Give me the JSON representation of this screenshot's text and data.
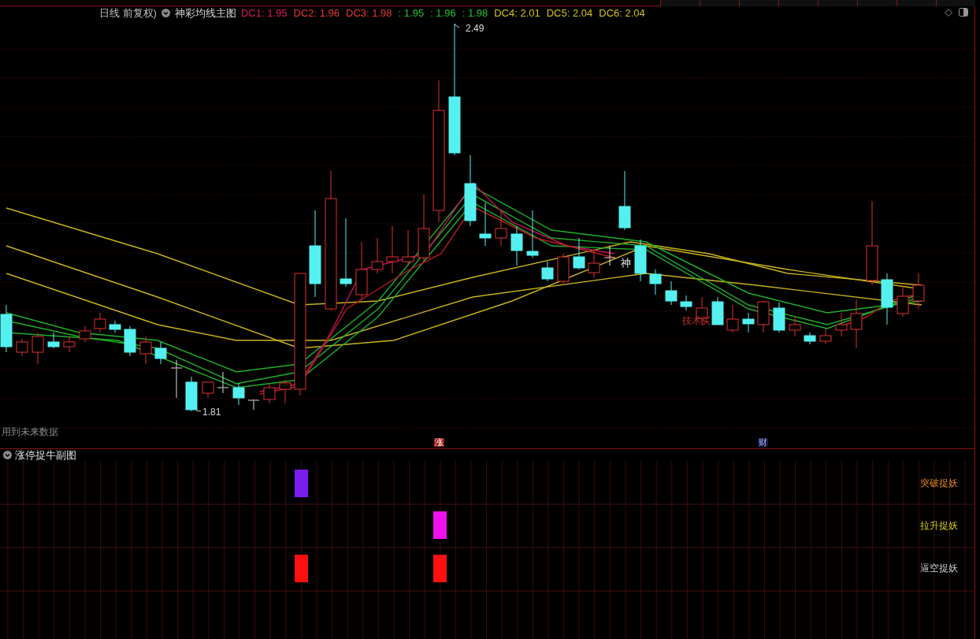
{
  "legend": {
    "period": "日线 前复权)",
    "indicator": "神彩均线主图",
    "values": [
      {
        "label": "DC1: 1.95",
        "color": "#d81b60"
      },
      {
        "label": "DC2: 1.96",
        "color": "#e53935"
      },
      {
        "label": "DC3: 1.98",
        "color": "#e53935"
      },
      {
        "label": ": 1.95",
        "color": "#22c32e"
      },
      {
        "label": ": 1.96",
        "color": "#22c32e"
      },
      {
        "label": ": 1.98",
        "color": "#22c32e"
      },
      {
        "label": "DC4: 2.01",
        "color": "#d4c21a"
      },
      {
        "label": "DC5: 2.04",
        "color": "#d4c21a"
      },
      {
        "label": "DC6: 2.04",
        "color": "#d4c21a"
      }
    ]
  },
  "main_chart": {
    "high_label": "2.49",
    "low_label": "1.81",
    "marks": [
      {
        "text": "神",
        "kind": "plain"
      },
      {
        "text": "技术买",
        "kind": "signal"
      }
    ],
    "note": "用到未来数据",
    "event_markers": [
      {
        "text": "涨",
        "kind": "limit-up"
      },
      {
        "text": "财",
        "kind": "finance"
      }
    ]
  },
  "sub_chart": {
    "title": "涨停捉牛副图",
    "rows": [
      {
        "label": "突破捉妖",
        "color": "#e8891c"
      },
      {
        "label": "拉升捉妖",
        "color": "#d8d21c"
      },
      {
        "label": "逼空捉妖",
        "color": "#d0d0d0"
      }
    ]
  }
}
